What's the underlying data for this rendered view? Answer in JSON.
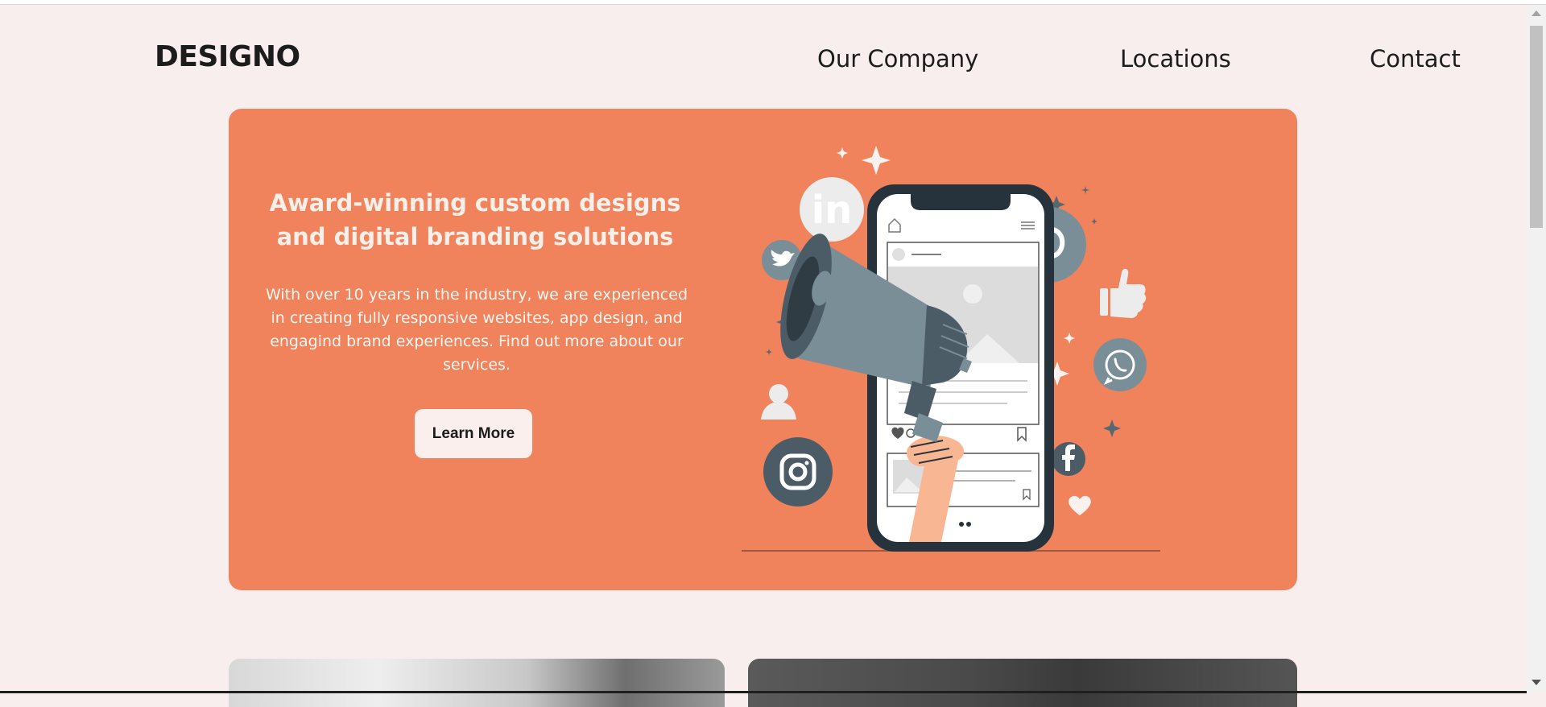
{
  "header": {
    "logo": "DESIGNO",
    "nav": [
      {
        "label": "Our Company"
      },
      {
        "label": "Locations"
      },
      {
        "label": "Contact"
      }
    ]
  },
  "hero": {
    "title": "Award-winning custom designs and digital branding solutions",
    "text": "With over 10 years in the industry, we are experienced in creating fully responsive websites, app design, and engagind brand experiences. Find out more about our services.",
    "button": "Learn More",
    "illustration": {
      "icons": [
        "linkedin-icon",
        "twitter-icon",
        "pinterest-icon",
        "whatsapp-icon",
        "instagram-icon",
        "facebook-icon",
        "thumbs-up-icon",
        "heart-icon",
        "user-icon",
        "megaphone-icon",
        "phone-icon"
      ]
    }
  },
  "colors": {
    "background": "#f8eeee",
    "hero": "#f0825c",
    "text_dark": "#1d1c1d",
    "icon_slate": "#7a8e98",
    "icon_dark": "#4a5a64"
  }
}
